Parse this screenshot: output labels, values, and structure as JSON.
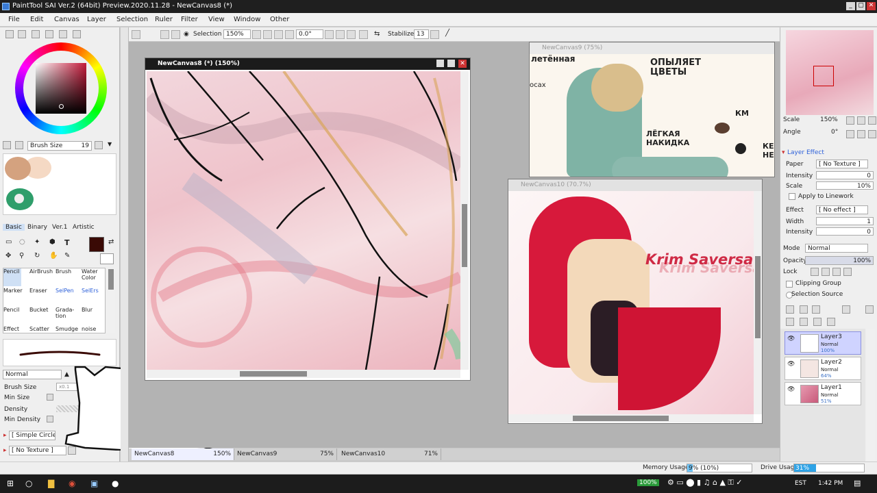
{
  "window": {
    "title": "PaintTool SAI Ver.2 (64bit) Preview.2020.11.28 - NewCanvas8 (*)",
    "controls": [
      "_",
      "▢",
      "✕"
    ]
  },
  "menu": [
    "File",
    "Edit",
    "Canvas",
    "Layer",
    "Selection",
    "Ruler",
    "Filter",
    "View",
    "Window",
    "Other"
  ],
  "toolbar": {
    "selection_label": "Selection",
    "zoom": "150%",
    "angle": "0.0°",
    "stabilizer_label": "Stabilizer",
    "stabilizer_value": "13"
  },
  "left": {
    "brush_size_label": "Brush Size",
    "brush_size_value": "19",
    "tabs": [
      "Basic",
      "Binary",
      "Ver.1",
      "Artistic"
    ],
    "tools": [
      {
        "name": "Pencil",
        "label": "Pencil"
      },
      {
        "name": "AirBrush",
        "label": "AirBrush"
      },
      {
        "name": "Brush",
        "label": "Brush"
      },
      {
        "name": "WaterColor",
        "label": "Water Color"
      },
      {
        "name": "Marker",
        "label": "Marker"
      },
      {
        "name": "Eraser",
        "label": "Eraser"
      },
      {
        "name": "SelPen",
        "label": "SelPen"
      },
      {
        "name": "SelErs",
        "label": "SelErs"
      },
      {
        "name": "Pencil2",
        "label": "Pencil"
      },
      {
        "name": "Bucket",
        "label": "Bucket"
      },
      {
        "name": "Gradation",
        "label": "Grada- tion"
      },
      {
        "name": "Blur",
        "label": "Blur"
      },
      {
        "name": "Effect",
        "label": "Effect"
      },
      {
        "name": "Scatter",
        "label": "Scatter"
      },
      {
        "name": "Smudge",
        "label": "Smudge"
      },
      {
        "name": "noise",
        "label": "noise"
      }
    ],
    "blend_mode": "Normal",
    "props": [
      {
        "label": "Brush Size",
        "value": "x0.1"
      },
      {
        "label": "Min Size",
        "value": ""
      },
      {
        "label": "Density",
        "value": ""
      },
      {
        "label": "Min Density",
        "value": ""
      }
    ],
    "shape": "[ Simple Circle ]",
    "texture": "[ No Texture ]"
  },
  "canvases": [
    {
      "title": "NewCanvas8 (*) (150%)",
      "active": true
    },
    {
      "title": "NewCanvas9 (75%)",
      "active": false
    },
    {
      "title": "NewCanvas10 (70.7%)",
      "active": false
    }
  ],
  "art": {
    "c9_text1": "летённая",
    "c9_text2": "ОПЫЛЯЕТ ЦВЕТЫ",
    "c9_text3": "осах",
    "c9_text4": "ЛЁГКАЯ НАКИДКА",
    "c9_text5": "КМ",
    "c9_text6": "КЕ НЕ",
    "c10_text1": "Krim Saversa",
    "c10_text2": "Krim Saversa"
  },
  "right": {
    "scale_label": "Scale",
    "scale_value": "150%",
    "angle_label": "Angle",
    "angle_value": "0°",
    "layer_effect_title": "Layer Effect",
    "paper_label": "Paper",
    "paper_value": "[ No Texture ]",
    "intensity_label": "Intensity",
    "intensity_value": "0",
    "pscale_label": "Scale",
    "pscale_value": "10%",
    "apply_label": "Apply to Linework",
    "effect_label": "Effect",
    "effect_value": "[ No effect ]",
    "width_label": "Width",
    "width_value": "1",
    "intensity2_label": "Intensity",
    "intensity2_value": "0",
    "mode_label": "Mode",
    "mode_value": "Normal",
    "opacity_label": "Opacity",
    "opacity_value": "100%",
    "lock_label": "Lock",
    "clipping_label": "Clipping Group",
    "selsource_label": "Selection Source",
    "layers": [
      {
        "name": "Layer3",
        "mode": "Normal",
        "opacity": "100%",
        "selected": true
      },
      {
        "name": "Layer2",
        "mode": "Normal",
        "opacity": "64%",
        "selected": false
      },
      {
        "name": "Layer1",
        "mode": "Normal",
        "opacity": "51%",
        "selected": false
      }
    ]
  },
  "tabs": [
    {
      "name": "NewCanvas8",
      "zoom": "150%"
    },
    {
      "name": "NewCanvas9",
      "zoom": "75%"
    },
    {
      "name": "NewCanvas10",
      "zoom": "71%"
    }
  ],
  "status": {
    "memory_label": "Memory Usage",
    "memory_value": "9% (10%)",
    "memory_fraction": 0.09,
    "drive_label": "Drive Usage",
    "drive_value": "31%",
    "drive_fraction": 0.31
  },
  "taskbar": {
    "battery": "100%",
    "lang": "EST",
    "time": "1:42 PM"
  }
}
